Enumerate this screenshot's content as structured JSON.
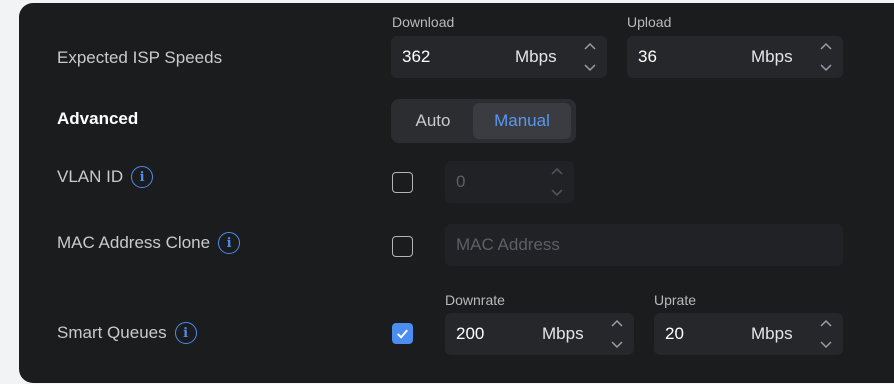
{
  "isp_speeds": {
    "label": "Expected ISP Speeds",
    "download": {
      "caption": "Download",
      "value": "362",
      "unit": "Mbps"
    },
    "upload": {
      "caption": "Upload",
      "value": "36",
      "unit": "Mbps"
    }
  },
  "advanced": {
    "label": "Advanced",
    "options": [
      "Auto",
      "Manual"
    ],
    "selected": "Manual"
  },
  "vlan": {
    "label": "VLAN ID",
    "checked": false,
    "value": "0"
  },
  "mac_clone": {
    "label": "MAC Address Clone",
    "checked": false,
    "placeholder": "MAC Address"
  },
  "smart_queues": {
    "label": "Smart Queues",
    "checked": true,
    "downrate": {
      "caption": "Downrate",
      "value": "200",
      "unit": "Mbps"
    },
    "uprate": {
      "caption": "Uprate",
      "value": "20",
      "unit": "Mbps"
    }
  },
  "colors": {
    "accent": "#4b8df0",
    "panel": "#1b1c1e",
    "field": "#25272b"
  },
  "icons": {
    "info": "info-icon",
    "check": "check-icon",
    "stepper_up": "chevron-up-icon",
    "stepper_down": "chevron-down-icon"
  }
}
